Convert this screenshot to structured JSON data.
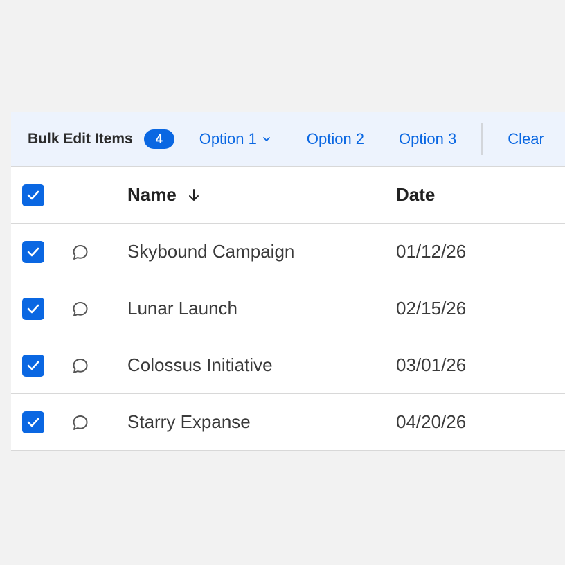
{
  "toolbar": {
    "title": "Bulk Edit Items",
    "count": "4",
    "option1": "Option 1",
    "option2": "Option 2",
    "option3": "Option 3",
    "clear": "Clear"
  },
  "table": {
    "columns": {
      "name": "Name",
      "date": "Date"
    },
    "rows": [
      {
        "name": "Skybound Campaign",
        "date": "01/12/26",
        "checked": true
      },
      {
        "name": "Lunar Launch",
        "date": "02/15/26",
        "checked": true
      },
      {
        "name": "Colossus Initiative",
        "date": "03/01/26",
        "checked": true
      },
      {
        "name": "Starry Expanse",
        "date": "04/20/26",
        "checked": true
      }
    ]
  },
  "colors": {
    "accent": "#0a67e2",
    "toolbar_bg": "#edf3fd",
    "page_bg": "#f2f2f2"
  },
  "icons": {
    "checkbox": "check-icon",
    "comment": "comment-icon",
    "sort": "arrow-down-icon",
    "dropdown": "chevron-down-icon"
  }
}
